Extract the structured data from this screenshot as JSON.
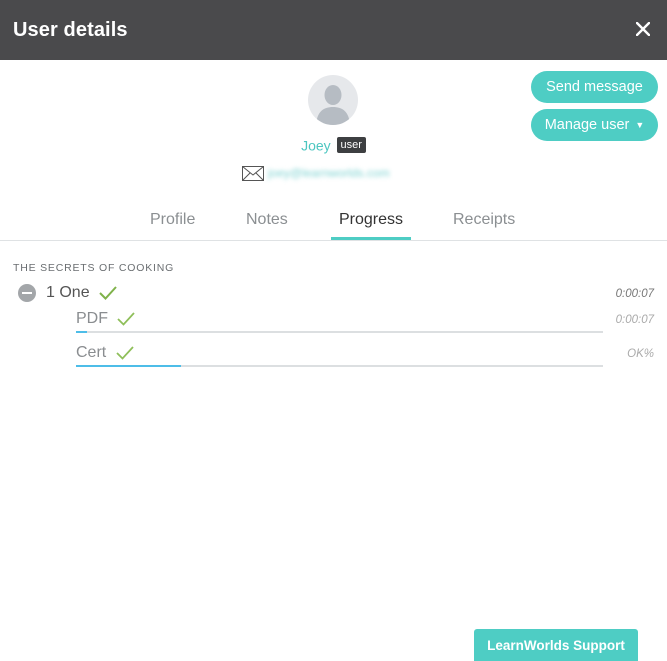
{
  "header": {
    "title": "User details"
  },
  "user": {
    "name": "Joey",
    "role": "user",
    "email": "joey@learnworlds.com"
  },
  "actions": {
    "send_message": "Send message",
    "manage_user": "Manage user"
  },
  "tabs": [
    {
      "label": "Profile",
      "active": false
    },
    {
      "label": "Notes",
      "active": false
    },
    {
      "label": "Progress",
      "active": true
    },
    {
      "label": "Receipts",
      "active": false
    }
  ],
  "progress": {
    "course_title": "THE SECRETS OF COOKING",
    "section": {
      "label": "1 One",
      "time": "0:00:07"
    },
    "units": [
      {
        "label": "PDF",
        "value": "0:00:07",
        "progress": 0.02
      },
      {
        "label": "Cert",
        "value": "OK%",
        "progress": 0.2
      }
    ]
  },
  "support": {
    "label": "LearnWorlds Support"
  },
  "colors": {
    "accent": "#4ecdc4",
    "header_bg": "#4a4a4c",
    "check": "#7fb24a",
    "progress_fill": "#4dbde8"
  }
}
